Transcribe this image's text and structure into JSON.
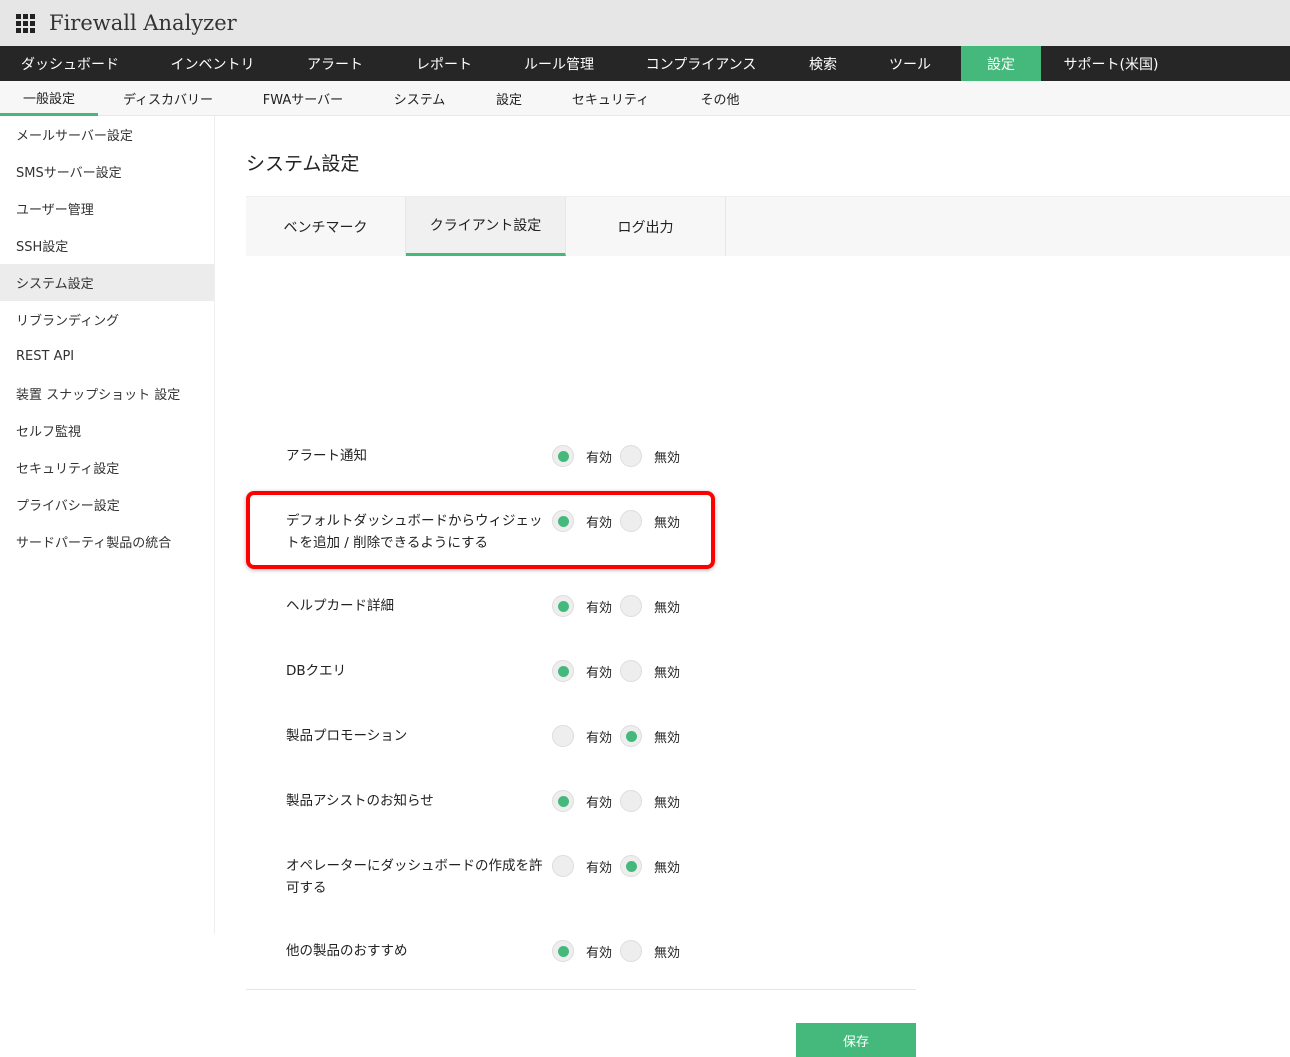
{
  "app": {
    "title": "Firewall Analyzer"
  },
  "nav": [
    {
      "label": "ダッシュボード",
      "w": 140
    },
    {
      "label": "インベントリ",
      "w": 145
    },
    {
      "label": "アラート",
      "w": 100
    },
    {
      "label": "レポート",
      "w": 118
    },
    {
      "label": "ルール管理",
      "w": 112
    },
    {
      "label": "コンプライアンス",
      "w": 172
    },
    {
      "label": "検索",
      "w": 72
    },
    {
      "label": "ツール",
      "w": 102
    },
    {
      "label": "設定",
      "w": 80,
      "active": true
    },
    {
      "label": "サポート(米国)",
      "w": 140
    }
  ],
  "subnav": [
    {
      "label": "一般設定",
      "w": 98,
      "active": true
    },
    {
      "label": "ディスカバリー",
      "w": 140
    },
    {
      "label": "FWAサーバー",
      "w": 130
    },
    {
      "label": "システム",
      "w": 103
    },
    {
      "label": "設定",
      "w": 76
    },
    {
      "label": "セキュリティ",
      "w": 127
    },
    {
      "label": "その他",
      "w": 92
    }
  ],
  "sidebar": [
    "メールサーバー設定",
    "SMSサーバー設定",
    "ユーザー管理",
    "SSH設定",
    "システム設定",
    "リブランディング",
    "REST API",
    "装置 スナップショット 設定",
    "セルフ監視",
    "セキュリティ設定",
    "プライバシー設定",
    "サードパーティ製品の統合"
  ],
  "sidebar_active": 4,
  "page_title": "システム設定",
  "tabs": [
    {
      "label": "ベンチマーク"
    },
    {
      "label": "クライアント設定",
      "active": true
    },
    {
      "label": "ログ出力"
    }
  ],
  "enable_label": "有効",
  "disable_label": "無効",
  "settings": [
    {
      "label": "アラート通知",
      "enabled": true
    },
    {
      "label": "デフォルトダッシュボードからウィジェットを追加 / 削除できるようにする",
      "enabled": true
    },
    {
      "label": "ヘルプカード詳細",
      "enabled": true
    },
    {
      "label": "DBクエリ",
      "enabled": true
    },
    {
      "label": "製品プロモーション",
      "enabled": false
    },
    {
      "label": "製品アシストのお知らせ",
      "enabled": true
    },
    {
      "label": "オペレーターにダッシュボードの作成を許可する",
      "enabled": false
    },
    {
      "label": "他の製品のおすすめ",
      "enabled": true
    }
  ],
  "save_label": "保存",
  "accent": "#45b97c"
}
